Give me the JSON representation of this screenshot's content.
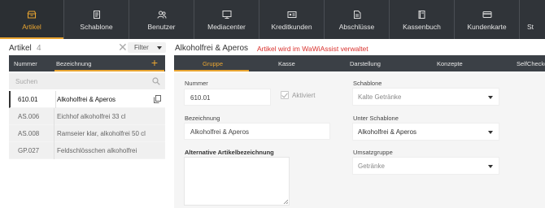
{
  "nav": [
    {
      "label": "Artikel",
      "icon": "box-icon",
      "active": true
    },
    {
      "label": "Schablone",
      "icon": "template-icon",
      "active": false
    },
    {
      "label": "Benutzer",
      "icon": "users-icon",
      "active": false
    },
    {
      "label": "Mediacenter",
      "icon": "monitor-icon",
      "active": false
    },
    {
      "label": "Kreditkunden",
      "icon": "id-card-icon",
      "active": false
    },
    {
      "label": "Abschlüsse",
      "icon": "document-icon",
      "active": false
    },
    {
      "label": "Kassenbuch",
      "icon": "book-icon",
      "active": false
    },
    {
      "label": "Kundenkarte",
      "icon": "card-icon",
      "active": false
    },
    {
      "label": "St",
      "icon": "settings-icon",
      "active": false
    }
  ],
  "left": {
    "title": "Artikel",
    "count": "4",
    "clear_symbol": "✕",
    "filter_label": "Filter",
    "columns": {
      "nummer": "Nummer",
      "bezeichnung": "Bezeichnung",
      "add": "+"
    },
    "search_placeholder": "Suchen",
    "rows": [
      {
        "nummer": "610.01",
        "bezeichnung": "Alkoholfrei & Aperos",
        "selected": true
      },
      {
        "nummer": "AS.006",
        "bezeichnung": "Eichhof alkoholfrei 33 cl",
        "selected": false
      },
      {
        "nummer": "AS.008",
        "bezeichnung": "Ramseier klar, alkoholfrei 50 cl",
        "selected": false
      },
      {
        "nummer": "GP.027",
        "bezeichnung": "Feldschlösschen alkoholfrei",
        "selected": false
      }
    ]
  },
  "right": {
    "title": "Alkoholfrei & Aperos",
    "notice": "Artikel wird im WaWiAssist verwaltet",
    "tabs": [
      "Gruppe",
      "Kasse",
      "Darstellung",
      "Konzepte",
      "SelfCheckout"
    ],
    "active_tab": "Gruppe",
    "form": {
      "nummer_label": "Nummer",
      "nummer_value": "610.01",
      "aktiviert_label": "Aktiviert",
      "bezeichnung_label": "Bezeichnung",
      "bezeichnung_value": "Alkoholfrei & Aperos",
      "alt_label": "Alternative Artikelbezeichnung",
      "schablone_label": "Schablone",
      "schablone_value": "Kalte Getränke",
      "unter_label": "Unter Schablone",
      "unter_value": "Alkoholfrei & Aperos",
      "umsatz_label": "Umsatzgruppe",
      "umsatz_value": "Getränke"
    }
  },
  "colors": {
    "accent": "#e9a531",
    "nav_bg": "#303439",
    "header_bg": "#3b4046",
    "notice": "#d9302c"
  }
}
